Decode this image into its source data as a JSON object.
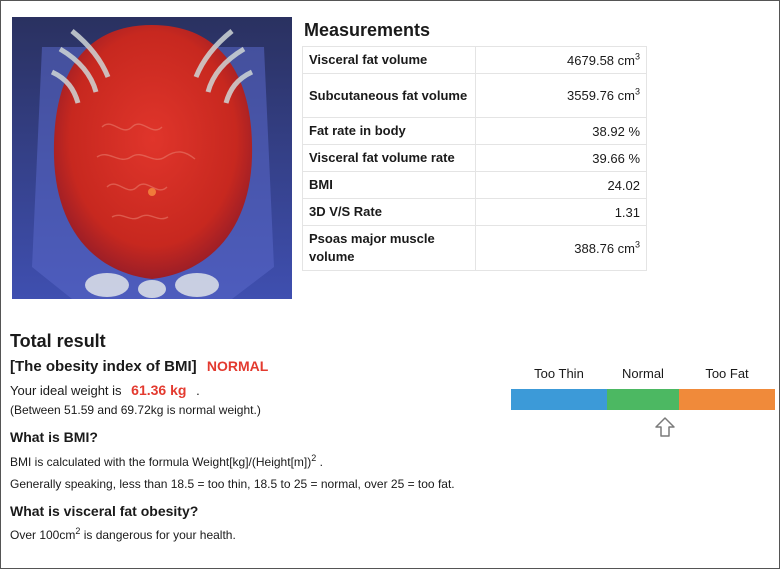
{
  "measurements": {
    "title": "Measurements",
    "rows": [
      {
        "label": "Visceral fat volume",
        "value": "4679.58 cm",
        "sup": "3"
      },
      {
        "label": "Subcutaneous fat volume",
        "value": "3559.76 cm",
        "sup": "3"
      },
      {
        "label": "Fat rate in body",
        "value": "38.92 %",
        "sup": ""
      },
      {
        "label": "Visceral fat volume rate",
        "value": "39.66 %",
        "sup": ""
      },
      {
        "label": "BMI",
        "value": "24.02",
        "sup": ""
      },
      {
        "label": "3D V/S Rate",
        "value": "1.31",
        "sup": ""
      },
      {
        "label": "Psoas major muscle volume",
        "value": "388.76 cm",
        "sup": "3"
      }
    ]
  },
  "result": {
    "title": "Total result",
    "bmi_heading": "[The obesity index of BMI]",
    "bmi_status": "NORMAL",
    "ideal_prefix": "Your ideal weight is",
    "ideal_weight": "61.36 kg",
    "ideal_suffix": ".",
    "between": "(Between 51.59 and 69.72kg is normal weight.)",
    "what_bmi": "What is BMI?",
    "formula_text": "BMI is calculated with the formula Weight[kg]/(Height[m])",
    "formula_sup": "2",
    "formula_end": " .",
    "generally": "Generally speaking, less than 18.5 = too thin, 18.5 to 25 = normal, over 25 = too fat.",
    "what_visceral": "What is visceral fat obesity?",
    "danger_prefix": "Over 100cm",
    "danger_sup": "2",
    "danger_suffix": " is dangerous for your health."
  },
  "scale": {
    "labels": [
      "Too Thin",
      "Normal",
      "Too Fat"
    ],
    "colors": [
      "#3c9ad8",
      "#4cb862",
      "#f08a3a"
    ],
    "indicator_icon": "up-arrow-icon"
  }
}
